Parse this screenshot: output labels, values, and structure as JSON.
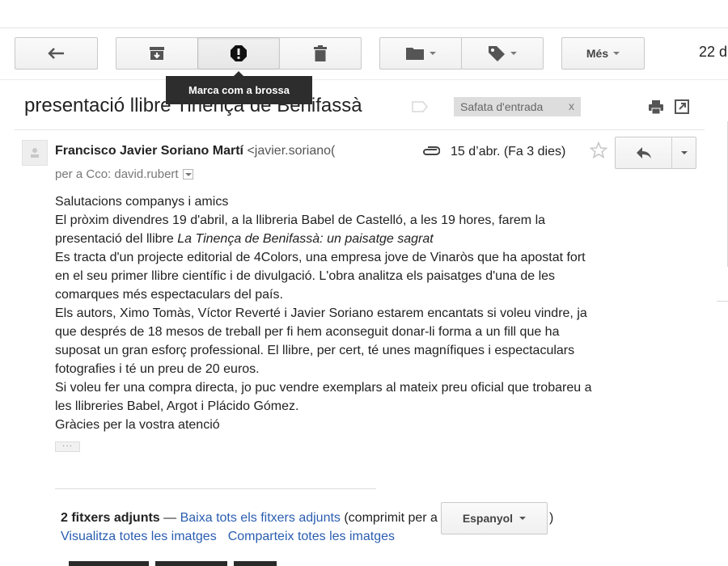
{
  "toolbar": {
    "more_label": "Més",
    "date_fragment": "22 d"
  },
  "tooltip": "Marca com a brossa",
  "subject": "presentació llibre Tinença de Benifassà",
  "label_chip": {
    "text": "Safata d'entrada",
    "remove": "x"
  },
  "message": {
    "sender_name": "Francisco Javier Soriano Martí",
    "sender_email": "<javier.soriano(",
    "date": "15 d’abr. (Fa 3 dies)",
    "recipients": "per a Cco: david.rubert",
    "body_lines": [
      "Salutacions companys i amics",
      "El pròxim divendres 19 d'abril, a la llibreria Babel de Castelló, a les 19 hores, farem la",
      "presentació del llibre ",
      "La Tinença de Benifassà: un paisatge sagrat",
      "Es tracta d'un projecte editorial de 4Colors, una empresa jove de Vinaròs que ha apostat fort",
      "en el seu primer llibre científic i de divulgació. L'obra analitza els paisatges d'una de les",
      "comarques més espectaculars del país.",
      "Els autors, Ximo Tomàs, Víctor Reverté i Javier Soriano estarem encantats si voleu vindre, ja",
      "que després de 18 mesos de treball per fi hem aconseguit donar-li forma a un fill que ha",
      "suposat un gran esforç professional. El llibre, per cert, té unes magnífiques i espectaculars",
      "fotografies i té un preu de 20 euros.",
      "Si voleu fer una compra directa, jo puc vendre exemplars al mateix preu oficial que trobareu a",
      "les llibreries Babel, Argot i Plácido Gómez.",
      "Gràcies per la vostra atenció"
    ],
    "trimmed_indicator": "···"
  },
  "attachments": {
    "count_label": "2 fitxers adjunts",
    "dash": " — ",
    "download_all": "Baixa tots els fitxers adjunts",
    "compressed_prefix": " (comprimit per a",
    "language": "Espanyol",
    "compressed_suffix": ")",
    "view_all_images": "Visualitza totes les imatges",
    "share_all_images": "Comparteix totes les imatges"
  },
  "colors": {
    "link": "#2a5db0",
    "tooltip_bg": "#2d2d2d",
    "chip_bg": "#dddddd"
  }
}
